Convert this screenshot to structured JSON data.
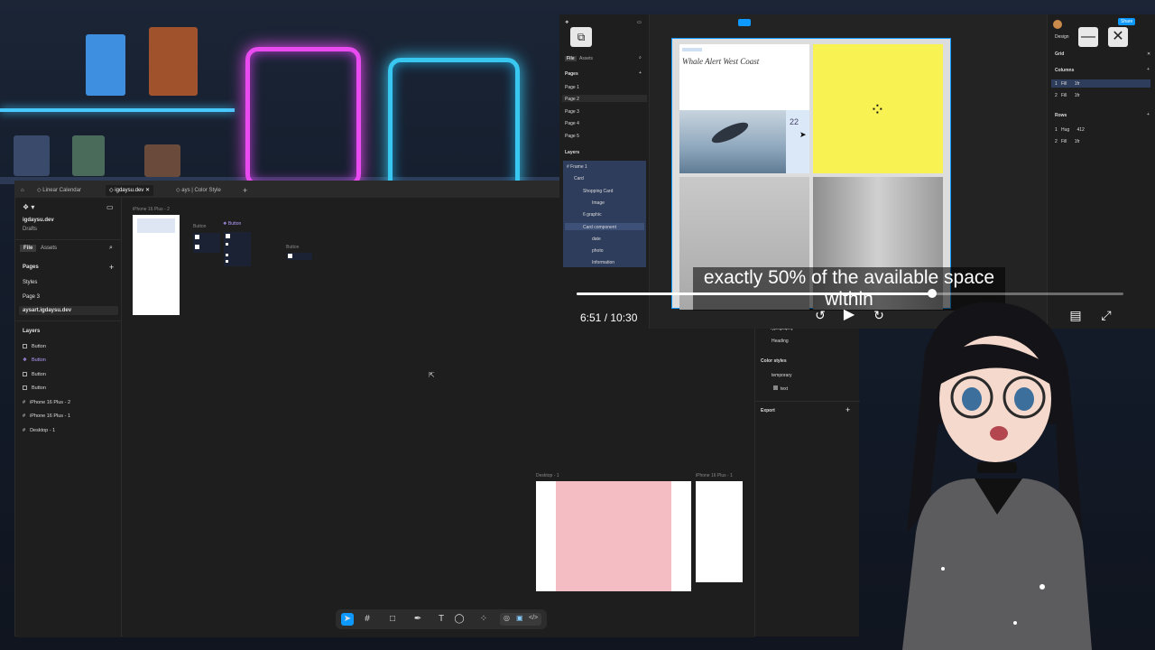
{
  "figma_main": {
    "tabs": [
      "Linear Calendar",
      "igdaysu.dev",
      "ays | Color Style"
    ],
    "file_name": "igdaysu.dev",
    "file_sub": "Drafts",
    "panel_tabs": [
      "File",
      "Assets"
    ],
    "pages_heading": "Pages",
    "pages": [
      "Styles",
      "Page 3",
      "aysart.igdaysu.dev"
    ],
    "layers_heading": "Layers",
    "layers": [
      "Button",
      "Button",
      "Button",
      "Button",
      "iPhone 16 Plus - 2",
      "iPhone 16 Plus - 1",
      "Desktop - 1"
    ],
    "canvas_labels": {
      "iphone2": "iPhone 16 Plus - 2",
      "button_a": "Button",
      "button_b": "Button",
      "button_c": "Button",
      "desktop1": "Desktop - 1",
      "iphone1": "iPhone 16 Plus - 1"
    },
    "help": "?"
  },
  "video_overlay": {
    "subtitle_line1": "exactly 50% of the available space",
    "subtitle_line2": "within",
    "time": "6:51 / 10:30",
    "progress_fraction": 0.65,
    "left_panel": {
      "panel_tabs": [
        "File",
        "Assets"
      ],
      "pages_heading": "Pages",
      "pages": [
        "Page 1",
        "Page 2",
        "Page 3",
        "Page 4",
        "Page 5"
      ],
      "layers_heading": "Layers",
      "layers": [
        "Frame 1",
        "Card",
        "Shopping Card",
        "Image",
        "6 graphic",
        "Card component",
        "date",
        "photo",
        "Information"
      ]
    },
    "card": {
      "title": "Whale Alert West Coast",
      "date": "22"
    },
    "right_panel": {
      "design_tab": "Design",
      "share": "Share",
      "grid_heading": "Grid",
      "columns_heading": "Columns",
      "columns": [
        {
          "n": "1",
          "type": "Fill",
          "size": "1fr"
        },
        {
          "n": "2",
          "type": "Fill",
          "size": "1fr"
        }
      ],
      "rows_heading": "Rows",
      "rows": [
        {
          "n": "1",
          "type": "Hug",
          "size": "412"
        },
        {
          "n": "2",
          "type": "Fill",
          "size": "1fr"
        }
      ]
    }
  },
  "side_panel": {
    "typography": "Typography",
    "heading": "Heading",
    "color_styles": "Color styles",
    "temporary": "temporary",
    "text": "text",
    "export": "Export"
  },
  "colors": {
    "accent": "#7b61ff",
    "selection": "#2e3d5c",
    "yellow": "#f8f253",
    "pink": "#f4bcc3",
    "neon_pink": "#e94bf0",
    "neon_blue": "#38c7f0"
  }
}
